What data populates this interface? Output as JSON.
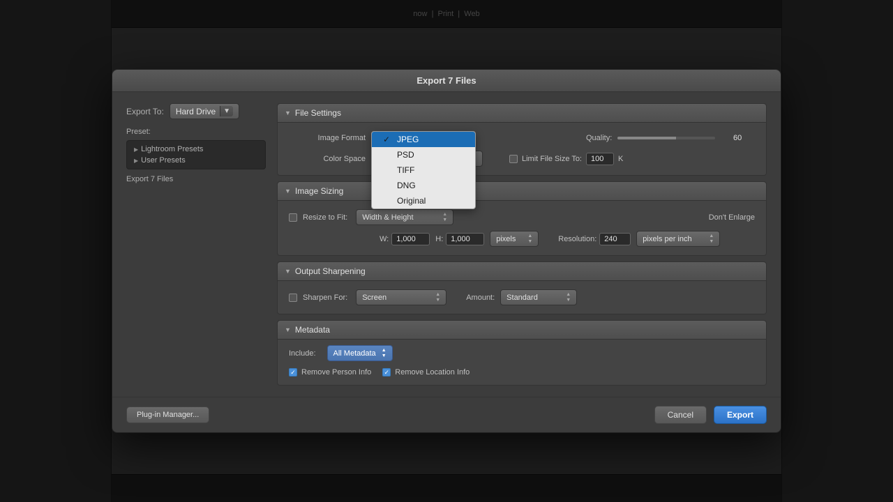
{
  "dialog": {
    "title": "Export 7 Files",
    "export_to_label": "Export To:",
    "export_to_value": "Hard Drive",
    "preset_label": "Preset:",
    "export_count": "Export 7 Files",
    "presets": [
      {
        "label": "Lightroom Presets"
      },
      {
        "label": "User Presets"
      }
    ]
  },
  "file_settings": {
    "section_label": "File Settings",
    "image_format_label": "Image Format",
    "image_format_options": [
      {
        "value": "JPEG",
        "selected": true
      },
      {
        "value": "PSD",
        "selected": false
      },
      {
        "value": "TIFF",
        "selected": false
      },
      {
        "value": "DNG",
        "selected": false
      },
      {
        "value": "Original",
        "selected": false
      }
    ],
    "quality_label": "Quality:",
    "quality_value": "60",
    "color_space_label": "Color Space",
    "limit_file_size_label": "Limit File Size To:",
    "limit_file_size_value": "100",
    "limit_file_size_unit": "K",
    "limit_file_size_checked": false
  },
  "image_sizing": {
    "section_label": "Image Sizing",
    "resize_label": "Resize to Fit:",
    "resize_value": "Width & Height",
    "dont_enlarge_label": "Don't Enlarge",
    "width_label": "W:",
    "width_value": "1,000",
    "height_label": "H:",
    "height_value": "1,000",
    "pixels_label": "pixels",
    "resolution_label": "Resolution:",
    "resolution_value": "240",
    "resolution_unit": "pixels per inch"
  },
  "output_sharpening": {
    "section_label": "Output Sharpening",
    "sharpen_for_label": "Sharpen For:",
    "sharpen_for_value": "Screen",
    "amount_label": "Amount:",
    "amount_value": "Standard"
  },
  "metadata": {
    "section_label": "Metadata",
    "include_label": "Include:",
    "include_value": "All Metadata",
    "remove_person_label": "Remove Person Info",
    "remove_person_checked": true,
    "remove_location_label": "Remove Location Info",
    "remove_location_checked": true
  },
  "footer": {
    "plugin_manager_label": "Plug-in Manager...",
    "cancel_label": "Cancel",
    "export_label": "Export"
  }
}
